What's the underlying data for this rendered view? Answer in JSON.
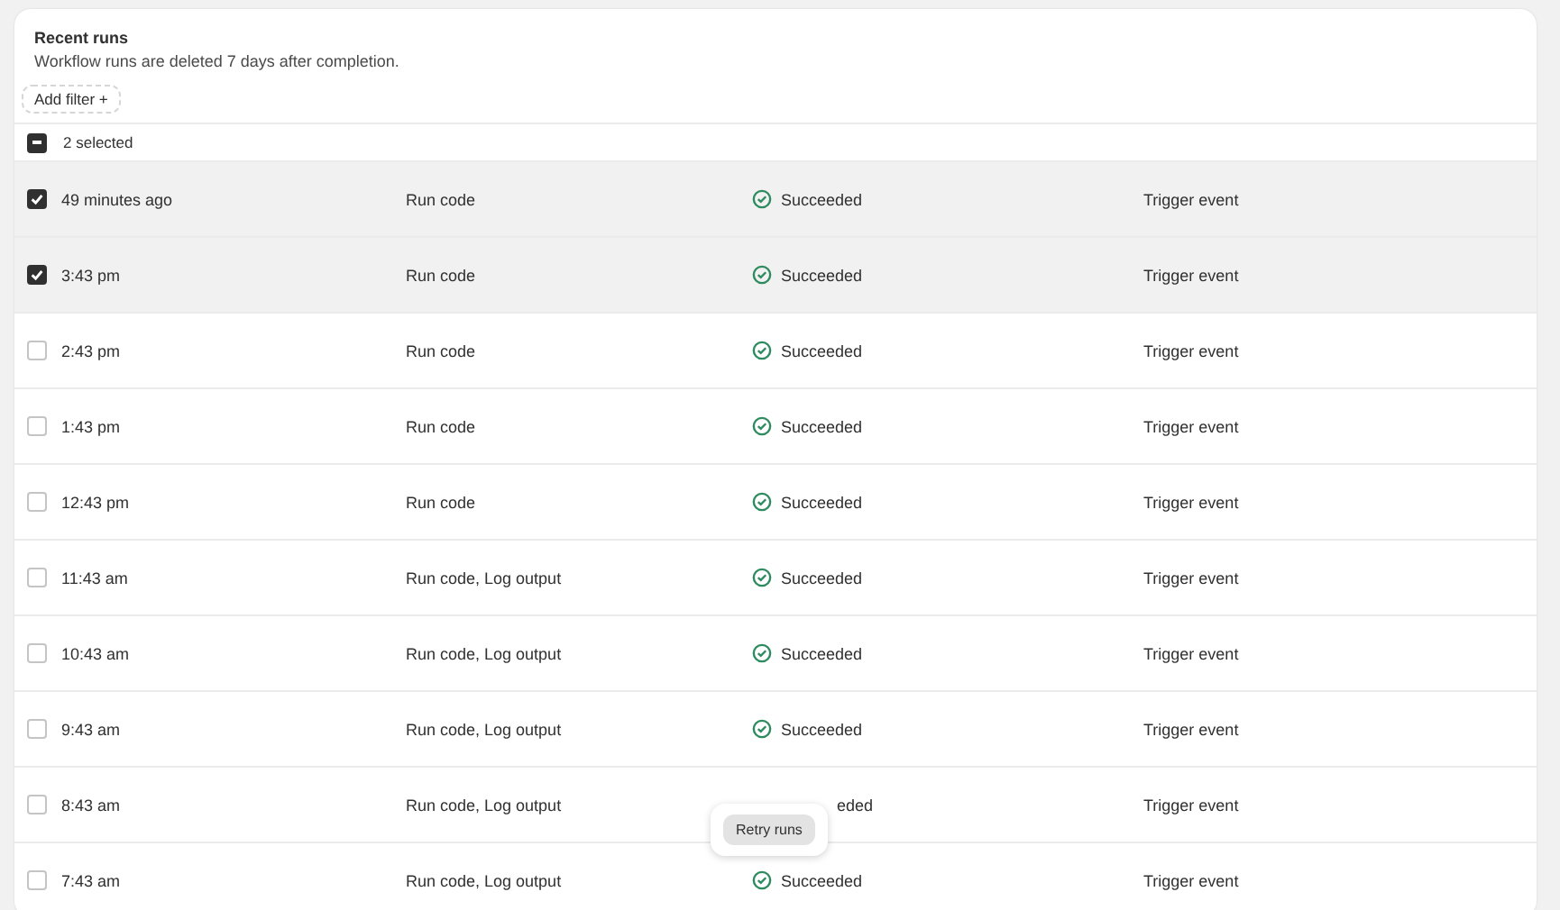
{
  "header": {
    "title": "Recent runs",
    "subtitle": "Workflow runs are deleted 7 days after completion.",
    "filter_button": "Add filter +"
  },
  "bulk": {
    "label": "2 selected",
    "checked": true,
    "indeterminate": true
  },
  "rows": [
    {
      "time": "49 minutes ago",
      "steps": "Run code",
      "status": "Succeeded",
      "trigger": "Trigger event",
      "selected": true
    },
    {
      "time": "3:43 pm",
      "steps": "Run code",
      "status": "Succeeded",
      "trigger": "Trigger event",
      "selected": true
    },
    {
      "time": "2:43 pm",
      "steps": "Run code",
      "status": "Succeeded",
      "trigger": "Trigger event",
      "selected": false
    },
    {
      "time": "1:43 pm",
      "steps": "Run code",
      "status": "Succeeded",
      "trigger": "Trigger event",
      "selected": false
    },
    {
      "time": "12:43 pm",
      "steps": "Run code",
      "status": "Succeeded",
      "trigger": "Trigger event",
      "selected": false
    },
    {
      "time": "11:43 am",
      "steps": "Run code, Log output",
      "status": "Succeeded",
      "trigger": "Trigger event",
      "selected": false
    },
    {
      "time": "10:43 am",
      "steps": "Run code, Log output",
      "status": "Succeeded",
      "trigger": "Trigger event",
      "selected": false
    },
    {
      "time": "9:43 am",
      "steps": "Run code, Log output",
      "status": "Succeeded",
      "trigger": "Trigger event",
      "selected": false
    },
    {
      "time": "8:43 am",
      "steps": "Run code, Log output",
      "status": "eded",
      "trigger": "Trigger event",
      "selected": false,
      "covered": true
    },
    {
      "time": "7:43 am",
      "steps": "Run code, Log output",
      "status": "Succeeded",
      "trigger": "Trigger event",
      "selected": false
    }
  ],
  "popover": {
    "button": "Retry runs"
  }
}
